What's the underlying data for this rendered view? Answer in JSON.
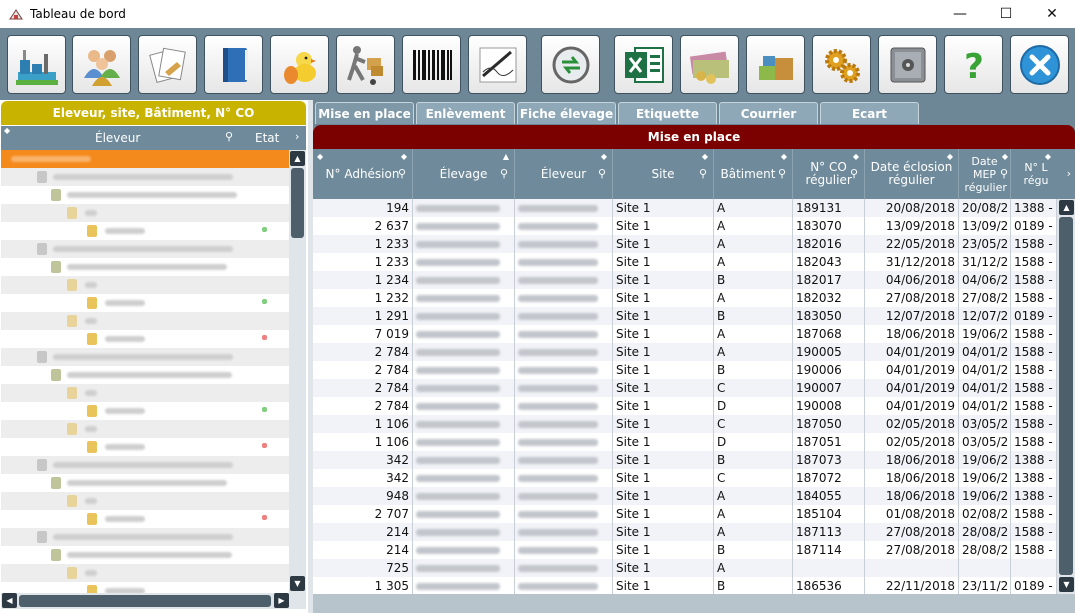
{
  "window": {
    "title": "Tableau de bord",
    "minimize": "—",
    "maximize": "☐",
    "close": "✕"
  },
  "toolbar": {
    "buttons": [
      {
        "name": "factory-button",
        "icon": "factory-icon"
      },
      {
        "name": "users-button",
        "icon": "users-icon"
      },
      {
        "name": "documents-button",
        "icon": "documents-icon"
      },
      {
        "name": "book-button",
        "icon": "book-icon"
      },
      {
        "name": "chick-button",
        "icon": "chick-icon"
      },
      {
        "name": "delivery-button",
        "icon": "hand-truck-icon"
      },
      {
        "name": "barcode-button",
        "icon": "barcode-icon"
      },
      {
        "name": "signature-button",
        "icon": "pen-icon"
      },
      {
        "name": "sync-button",
        "icon": "sync-icon"
      },
      {
        "name": "excel-button",
        "icon": "excel-icon"
      },
      {
        "name": "money-button",
        "icon": "banknotes-icon"
      },
      {
        "name": "boxes-button",
        "icon": "boxes-icon"
      },
      {
        "name": "settings-button",
        "icon": "gears-icon"
      },
      {
        "name": "safe-button",
        "icon": "safe-icon"
      },
      {
        "name": "help-button",
        "icon": "question-icon"
      },
      {
        "name": "exit-button",
        "icon": "close-circle-icon"
      }
    ]
  },
  "left": {
    "header": "Eleveur, site, Bâtiment, N° CO",
    "col_eleveur": "Éleveur",
    "col_etat": "Etat"
  },
  "tabs": [
    {
      "label": "Mise en place"
    },
    {
      "label": "Enlèvement"
    },
    {
      "label": "Fiche élevage"
    },
    {
      "label": "Etiquette"
    },
    {
      "label": "Courrier"
    },
    {
      "label": "Ecart"
    }
  ],
  "main": {
    "header": "Mise en place",
    "columns": [
      {
        "label": "N° Adhésion"
      },
      {
        "label": "Élevage"
      },
      {
        "label": "Éleveur"
      },
      {
        "label": "Site"
      },
      {
        "label": "Bâtiment"
      },
      {
        "label": "N° CO régulier"
      },
      {
        "label": "Date éclosion régulier"
      },
      {
        "label": "Date MEP régulier"
      },
      {
        "label": "N° L régu"
      }
    ],
    "rows": [
      {
        "adh": "194",
        "site": "Site 1",
        "bat": "A",
        "co": "189131",
        "ecl": "20/08/2018",
        "mep": "20/08/2",
        "lot": "1388 -"
      },
      {
        "adh": "2 637",
        "site": "Site 1",
        "bat": "A",
        "co": "183070",
        "ecl": "13/09/2018",
        "mep": "13/09/2",
        "lot": "0189 -"
      },
      {
        "adh": "1 233",
        "site": "Site 1",
        "bat": "A",
        "co": "182016",
        "ecl": "22/05/2018",
        "mep": "23/05/2",
        "lot": "1588 -"
      },
      {
        "adh": "1 233",
        "site": "Site 1",
        "bat": "A",
        "co": "182043",
        "ecl": "31/12/2018",
        "mep": "31/12/2",
        "lot": "1588 -"
      },
      {
        "adh": "1 234",
        "site": "Site 1",
        "bat": "B",
        "co": "182017",
        "ecl": "04/06/2018",
        "mep": "04/06/2",
        "lot": "1588 -"
      },
      {
        "adh": "1 232",
        "site": "Site 1",
        "bat": "A",
        "co": "182032",
        "ecl": "27/08/2018",
        "mep": "27/08/2",
        "lot": "1588 -"
      },
      {
        "adh": "1 291",
        "site": "Site 1",
        "bat": "B",
        "co": "183050",
        "ecl": "12/07/2018",
        "mep": "12/07/2",
        "lot": "0189 -"
      },
      {
        "adh": "7 019",
        "site": "Site 1",
        "bat": "A",
        "co": "187068",
        "ecl": "18/06/2018",
        "mep": "19/06/2",
        "lot": "1588 -"
      },
      {
        "adh": "2 784",
        "site": "Site 1",
        "bat": "A",
        "co": "190005",
        "ecl": "04/01/2019",
        "mep": "04/01/2",
        "lot": "1588 -"
      },
      {
        "adh": "2 784",
        "site": "Site 1",
        "bat": "B",
        "co": "190006",
        "ecl": "04/01/2019",
        "mep": "04/01/2",
        "lot": "1588 -"
      },
      {
        "adh": "2 784",
        "site": "Site 1",
        "bat": "C",
        "co": "190007",
        "ecl": "04/01/2019",
        "mep": "04/01/2",
        "lot": "1588 -"
      },
      {
        "adh": "2 784",
        "site": "Site 1",
        "bat": "D",
        "co": "190008",
        "ecl": "04/01/2019",
        "mep": "04/01/2",
        "lot": "1588 -"
      },
      {
        "adh": "1 106",
        "site": "Site 1",
        "bat": "C",
        "co": "187050",
        "ecl": "02/05/2018",
        "mep": "03/05/2",
        "lot": "1588 -"
      },
      {
        "adh": "1 106",
        "site": "Site 1",
        "bat": "D",
        "co": "187051",
        "ecl": "02/05/2018",
        "mep": "03/05/2",
        "lot": "1588 -"
      },
      {
        "adh": "342",
        "site": "Site 1",
        "bat": "B",
        "co": "187073",
        "ecl": "18/06/2018",
        "mep": "19/06/2",
        "lot": "1388 -"
      },
      {
        "adh": "342",
        "site": "Site 1",
        "bat": "C",
        "co": "187072",
        "ecl": "18/06/2018",
        "mep": "19/06/2",
        "lot": "1388 -"
      },
      {
        "adh": "948",
        "site": "Site 1",
        "bat": "A",
        "co": "184055",
        "ecl": "18/06/2018",
        "mep": "19/06/2",
        "lot": "1388 -"
      },
      {
        "adh": "2 707",
        "site": "Site 1",
        "bat": "A",
        "co": "185104",
        "ecl": "01/08/2018",
        "mep": "02/08/2",
        "lot": "1588 -"
      },
      {
        "adh": "214",
        "site": "Site 1",
        "bat": "A",
        "co": "187113",
        "ecl": "27/08/2018",
        "mep": "28/08/2",
        "lot": "1588 -"
      },
      {
        "adh": "214",
        "site": "Site 1",
        "bat": "B",
        "co": "187114",
        "ecl": "27/08/2018",
        "mep": "28/08/2",
        "lot": "1588 -"
      },
      {
        "adh": "725",
        "site": "Site 1",
        "bat": "A",
        "co": "",
        "ecl": "",
        "mep": "",
        "lot": ""
      },
      {
        "adh": "1 305",
        "site": "Site 1",
        "bat": "B",
        "co": "186536",
        "ecl": "22/11/2018",
        "mep": "23/11/2",
        "lot": "0189 -"
      }
    ]
  }
}
